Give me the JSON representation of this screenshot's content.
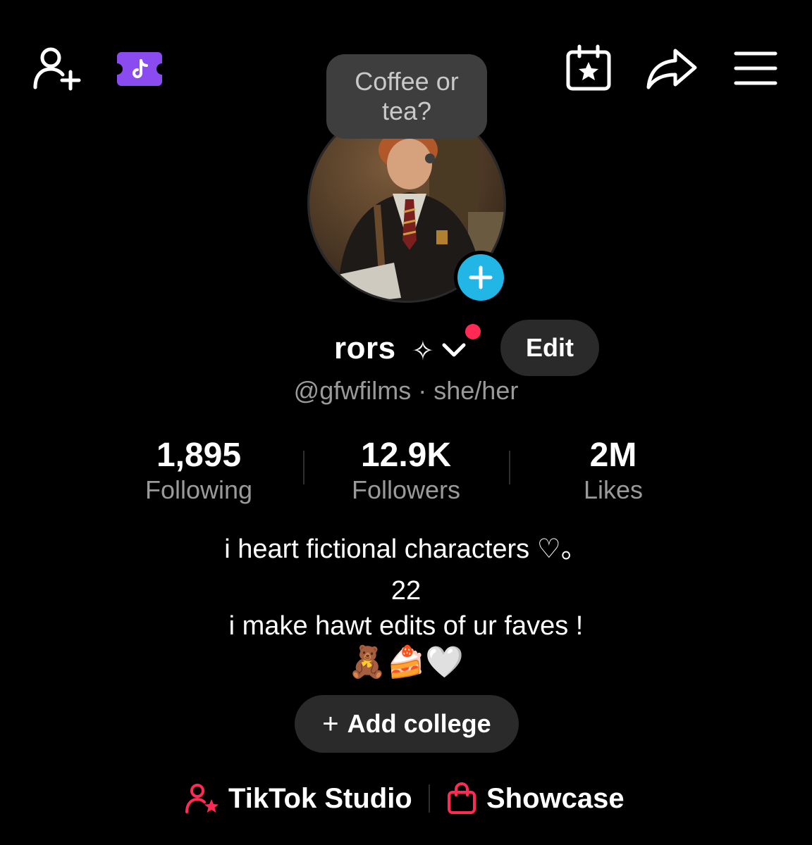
{
  "topbar": {
    "add_friend_icon": "person-add-icon",
    "promo_icon": "tiktok-ticket-icon",
    "calendar_icon": "calendar-star-icon",
    "share_icon": "share-arrow-icon",
    "menu_icon": "hamburger-menu-icon",
    "promo_color": "#8a4cf0"
  },
  "note": {
    "text": "Coffee or tea?"
  },
  "profile": {
    "name": "rors",
    "sparkle": "✧",
    "handle": "@gfwfilms",
    "separator": "·",
    "pronouns": "she/her",
    "edit_label": "Edit",
    "add_button_color": "#22b6e6",
    "notification_dot_color": "#ff2b55"
  },
  "stats": {
    "following_count": "1,895",
    "following_label": "Following",
    "followers_count": "12.9K",
    "followers_label": "Followers",
    "likes_count": "2M",
    "likes_label": "Likes"
  },
  "bio": {
    "line1": "i heart fictional characters ♡。",
    "line2": "22",
    "line3": "i make hawt edits of ur faves !",
    "line4": "🧸🍰🤍"
  },
  "college": {
    "plus": "+",
    "label": "Add college"
  },
  "links": {
    "studio_label": "TikTok Studio",
    "showcase_label": "Showcase",
    "accent": "#ff2b55"
  }
}
